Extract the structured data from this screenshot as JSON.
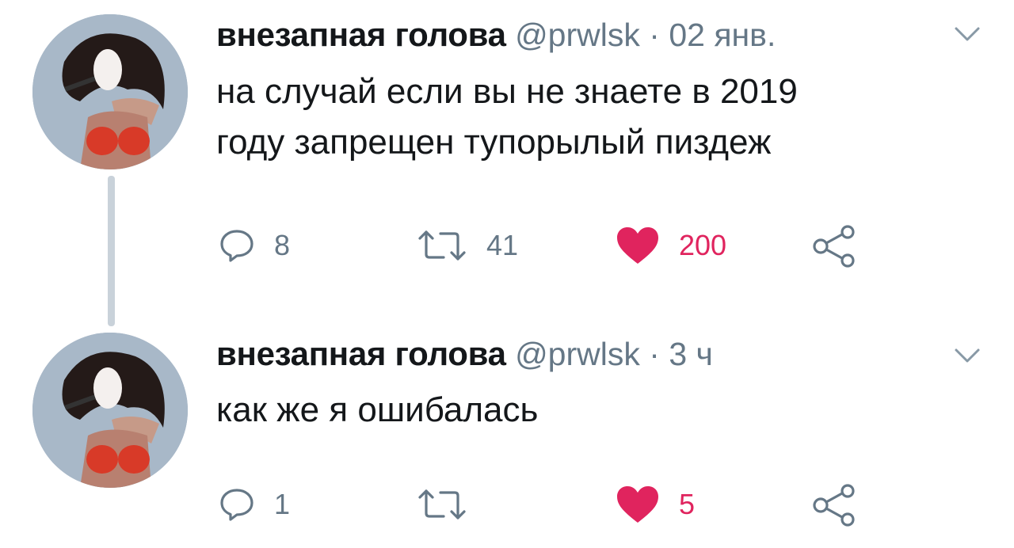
{
  "tweets": [
    {
      "name": "внезапная голова",
      "handle": "@prwlsk",
      "separator": "·",
      "time": "02 янв.",
      "lines": [
        "на случай если вы не знаете в 2019",
        "году запрещен тупорылый пиздеж"
      ],
      "replies": "8",
      "retweets": "41",
      "likes": "200",
      "liked": true
    },
    {
      "name": "внезапная голова",
      "handle": "@prwlsk",
      "separator": "·",
      "time": "3 ч",
      "lines": [
        "как же я ошибалась"
      ],
      "replies": "1",
      "retweets": "",
      "likes": "5",
      "liked": true
    }
  ],
  "colors": {
    "like": "#e0245e",
    "muted": "#657786",
    "text": "#14171a",
    "thread": "#c9d2da"
  },
  "icons": {
    "reply": "reply-icon",
    "retweet": "retweet-icon",
    "like": "heart-icon",
    "share": "share-icon",
    "menu": "chevron-down-icon"
  }
}
